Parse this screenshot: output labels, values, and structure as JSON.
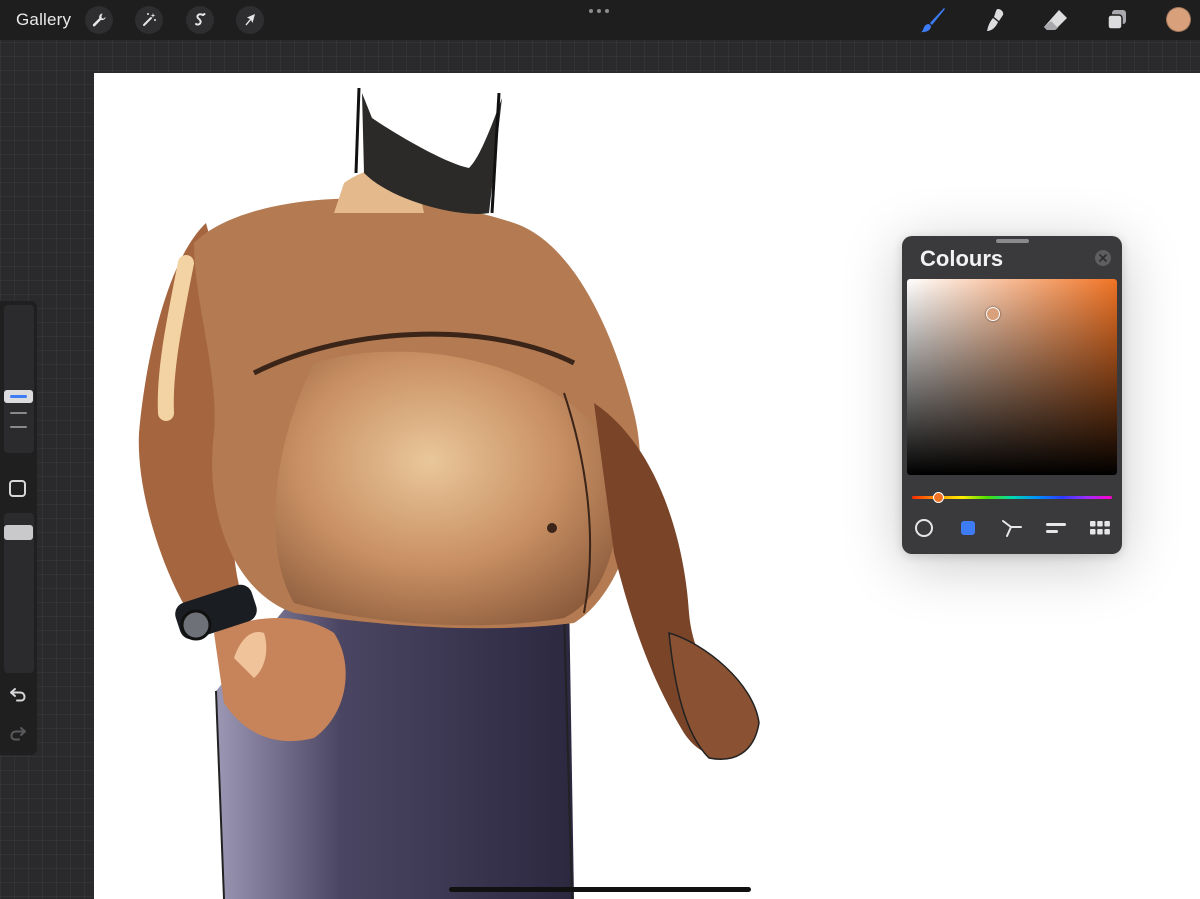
{
  "toolbar": {
    "gallery_label": "Gallery",
    "left_tools": [
      "wrench-icon",
      "magic-wand-icon",
      "selection-icon",
      "transform-arrow-icon"
    ],
    "right_tools": [
      "brush-icon",
      "smudge-icon",
      "eraser-icon",
      "layers-icon"
    ],
    "active_tool": "brush",
    "current_colour": "#d9a07c"
  },
  "sidebar": {
    "brush_size_slider": "brush-size",
    "opacity_slider": "brush-opacity",
    "controls": [
      "modify-square",
      "undo-icon",
      "redo-icon"
    ]
  },
  "colours_panel": {
    "title": "Colours",
    "hue_colour": "#f07324",
    "tabs": [
      "disc",
      "classic",
      "harmony",
      "value",
      "palettes"
    ],
    "active_tab": "classic",
    "accent": "#3d7cf5"
  }
}
